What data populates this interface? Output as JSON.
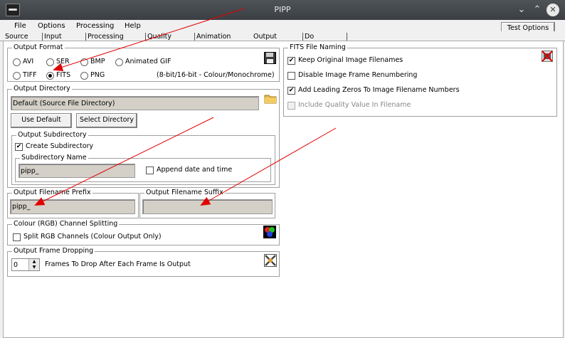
{
  "window": {
    "title": "PIPP"
  },
  "menu": {
    "items": [
      "File",
      "Options",
      "Processing",
      "Help"
    ]
  },
  "toolbar": {
    "test_options_label": "Test Options"
  },
  "tabs": [
    "Source",
    "Input",
    "Processing",
    "Quality",
    "Animation",
    "Output",
    "Do"
  ],
  "output_format": {
    "legend": "Output Format",
    "options": [
      {
        "label": "AVI",
        "selected": false
      },
      {
        "label": "SER",
        "selected": false
      },
      {
        "label": "BMP",
        "selected": false
      },
      {
        "label": "Animated GIF",
        "selected": false
      },
      {
        "label": "TIFF",
        "selected": false
      },
      {
        "label": "FITS",
        "selected": true
      },
      {
        "label": "PNG",
        "selected": false
      }
    ],
    "note": "(8-bit/16-bit - Colour/Monochrome)"
  },
  "output_directory": {
    "legend": "Output Directory",
    "value": "Default (Source File Directory)",
    "use_default_label": "Use Default",
    "select_directory_label": "Select Directory",
    "subdirectory": {
      "legend": "Output Subdirectory",
      "create_label": "Create Subdirectory",
      "create_checked": true,
      "name_legend": "Subdirectory Name",
      "name_value": "pipp_",
      "append_date_label": "Append date and time",
      "append_date_checked": false
    }
  },
  "filename_prefix": {
    "legend": "Output Filename Prefix",
    "value": "pipp_"
  },
  "filename_suffix": {
    "legend": "Output Filename Suffix",
    "value": ""
  },
  "channel_splitting": {
    "legend": "Colour (RGB) Channel Splitting",
    "split_label": "Split RGB Channels (Colour Output Only)",
    "split_checked": false
  },
  "frame_dropping": {
    "legend": "Output Frame Dropping",
    "value": "0",
    "label": "Frames To Drop After Each Frame Is Output"
  },
  "fits_naming": {
    "legend": "FITS File Naming",
    "options": [
      {
        "label": "Keep Original Image Filenames",
        "checked": true,
        "disabled": false
      },
      {
        "label": "Disable Image Frame Renumbering",
        "checked": false,
        "disabled": false
      },
      {
        "label": "Add Leading Zeros To Image Filename Numbers",
        "checked": true,
        "disabled": false
      },
      {
        "label": "Include Quality Value In Filename",
        "checked": false,
        "disabled": true
      }
    ]
  },
  "colors": {
    "titlebar": "#3b3f43",
    "field": "#d4d0c8",
    "annotation_arrow": "#e00000"
  },
  "icons": [
    "app-icon",
    "chevron-down-icon",
    "chevron-up-icon",
    "close-icon",
    "floppy-disk-icon",
    "folder-icon",
    "rgb-channels-icon",
    "frame-drop-icon",
    "fits-disabled-icon"
  ]
}
